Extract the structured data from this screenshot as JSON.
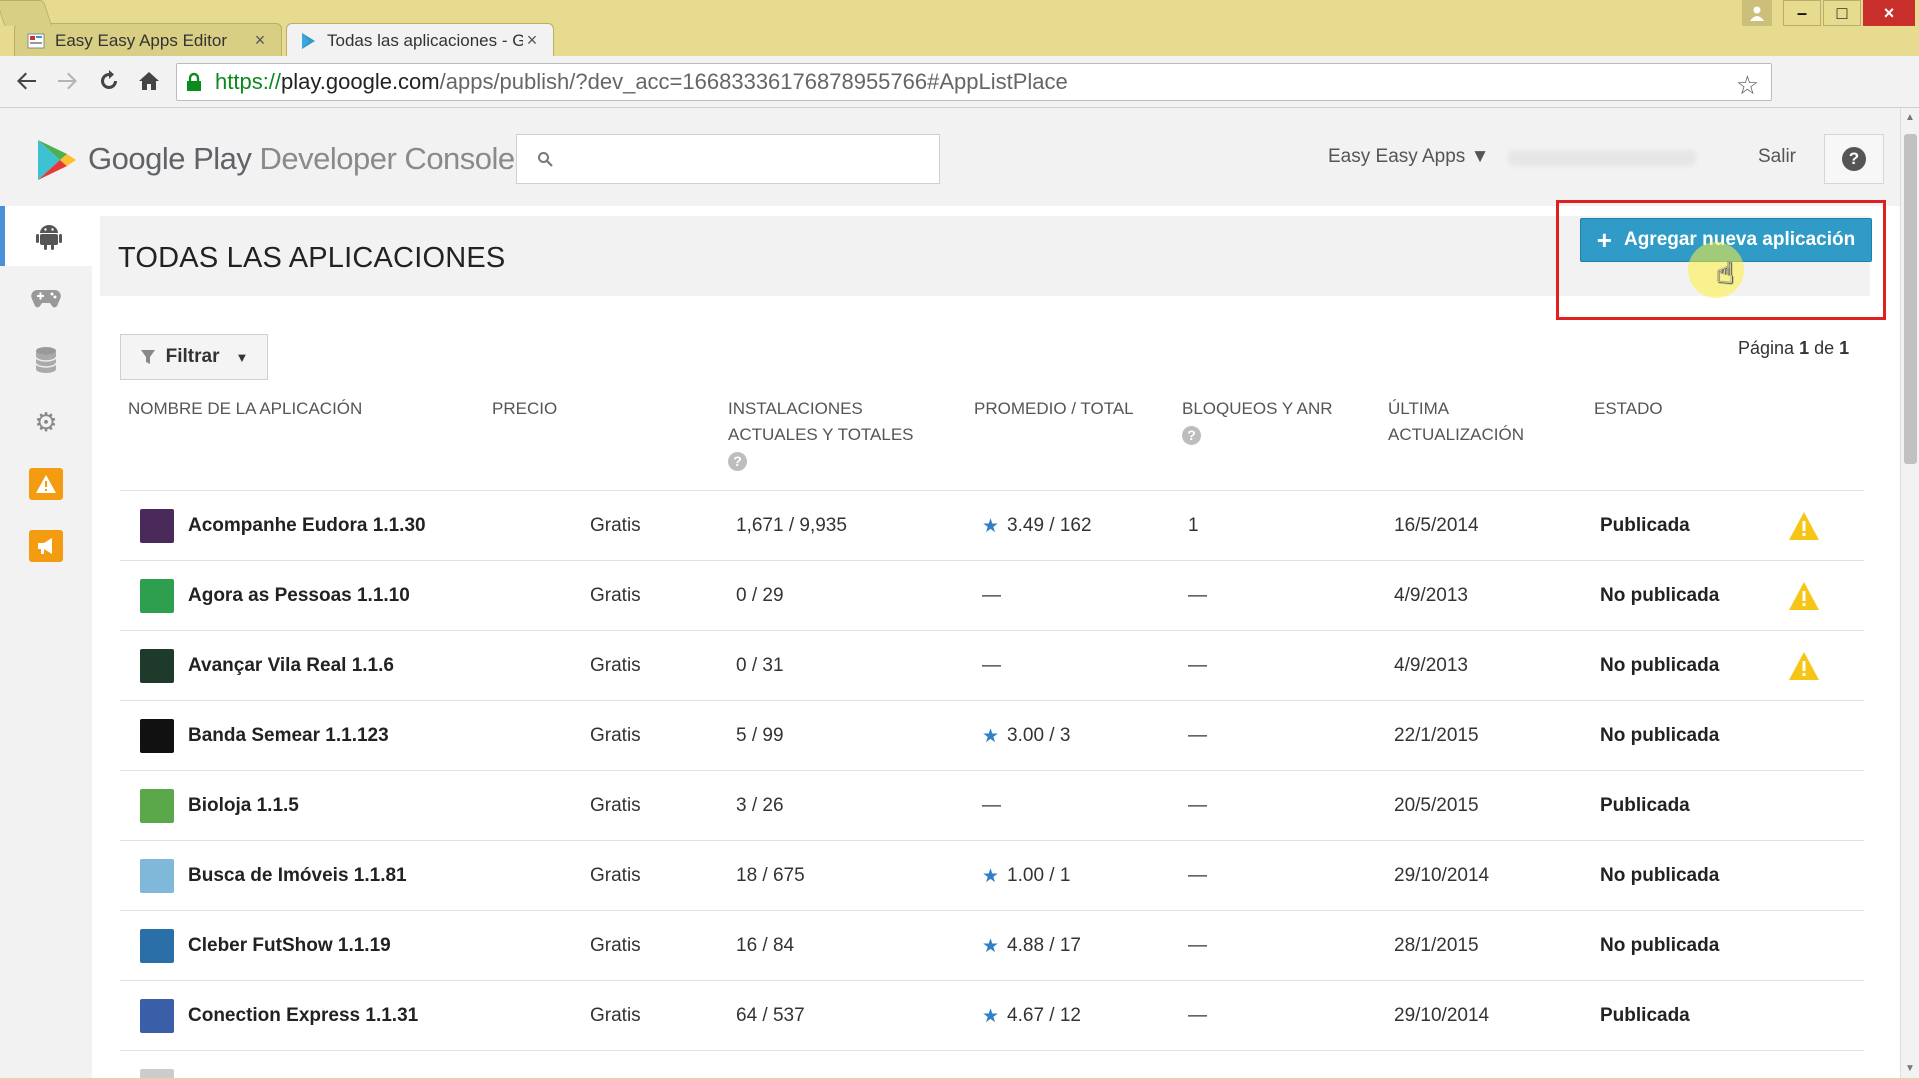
{
  "browser": {
    "tabs": [
      {
        "title": "Easy Easy Apps Editor",
        "close": "×"
      },
      {
        "title": "Todas las aplicaciones - G",
        "close": "×"
      }
    ],
    "window_buttons": {
      "minimize": "–",
      "maximize": "□",
      "close": "×"
    },
    "url": {
      "scheme": "https://",
      "host": "play.google.com",
      "path": "/apps/publish/?dev_acc=16683336176878955766#AppListPlace"
    },
    "extension_label": "⌘"
  },
  "header": {
    "brand_google_play": "Google Play",
    "brand_console": "Developer Console",
    "search_placeholder": "",
    "account": "Easy Easy Apps ▼",
    "signout": "Salir",
    "help": "?"
  },
  "colors": {
    "accent_button": "#2f9bc6",
    "highlight_box": "#e02020",
    "rating_star": "#2f80c8",
    "warning": "#f5c518",
    "sidebar_orange": "#f39c12"
  },
  "sidebar": {
    "items": [
      {
        "icon": "android-icon",
        "glyph": "🤖"
      },
      {
        "icon": "gamepad-icon",
        "glyph": "🎮"
      },
      {
        "icon": "database-icon",
        "glyph": "≣"
      },
      {
        "icon": "gear-icon",
        "glyph": "⚙"
      },
      {
        "icon": "alert-icon",
        "glyph": "!"
      },
      {
        "icon": "announcement-icon",
        "glyph": "📢"
      }
    ]
  },
  "main": {
    "title": "TODAS LAS APLICACIONES",
    "add_button": "Agregar nueva aplicación",
    "filter_button": "Filtrar",
    "pager": {
      "prefix": "Página",
      "current": "1",
      "separator": "de",
      "total": "1"
    },
    "columns": [
      {
        "line1": "NOMBRE DE LA APLICACIÓN",
        "line2": "",
        "help": false
      },
      {
        "line1": "PRECIO",
        "line2": "",
        "help": false
      },
      {
        "line1": "INSTALACIONES",
        "line2": "ACTUALES Y TOTALES",
        "help": true
      },
      {
        "line1": "PROMEDIO / TOTAL",
        "line2": "",
        "help": false
      },
      {
        "line1": "BLOQUEOS Y ANR",
        "line2": "",
        "help": true
      },
      {
        "line1": "ÚLTIMA",
        "line2": "ACTUALIZACIÓN",
        "help": false
      },
      {
        "line1": "ESTADO",
        "line2": "",
        "help": false
      }
    ],
    "apps": [
      {
        "name": "Acompanhe Eudora 1.1.30",
        "price": "Gratis",
        "installs": "1,671  /  9,935",
        "rating": "3.49  /  162",
        "crashes": "1",
        "updated": "16/5/2014",
        "status": "Publicada",
        "warning": true,
        "icon_color": "#4a2a5a"
      },
      {
        "name": "Agora as Pessoas 1.1.10",
        "price": "Gratis",
        "installs": "0  /  29",
        "rating": "—",
        "crashes": "—",
        "updated": "4/9/2013",
        "status": "No publicada",
        "warning": true,
        "icon_color": "#2e9e4f"
      },
      {
        "name": "Avançar Vila Real 1.1.6",
        "price": "Gratis",
        "installs": "0  /  31",
        "rating": "—",
        "crashes": "—",
        "updated": "4/9/2013",
        "status": "No publicada",
        "warning": true,
        "icon_color": "#1e3a2a"
      },
      {
        "name": "Banda Semear 1.1.123",
        "price": "Gratis",
        "installs": "5  /  99",
        "rating": "3.00  /  3",
        "crashes": "—",
        "updated": "22/1/2015",
        "status": "No publicada",
        "warning": false,
        "icon_color": "#111111"
      },
      {
        "name": "Bioloja 1.1.5",
        "price": "Gratis",
        "installs": "3  /  26",
        "rating": "—",
        "crashes": "—",
        "updated": "20/5/2015",
        "status": "Publicada",
        "warning": false,
        "icon_color": "#5aa84a"
      },
      {
        "name": "Busca de Imóveis 1.1.81",
        "price": "Gratis",
        "installs": "18  /  675",
        "rating": "1.00  /  1",
        "crashes": "—",
        "updated": "29/10/2014",
        "status": "No publicada",
        "warning": false,
        "icon_color": "#7fb8d8"
      },
      {
        "name": "Cleber FutShow 1.1.19",
        "price": "Gratis",
        "installs": "16  /  84",
        "rating": "4.88  /  17",
        "crashes": "—",
        "updated": "28/1/2015",
        "status": "No publicada",
        "warning": false,
        "icon_color": "#2a6fa8"
      },
      {
        "name": "Conection Express 1.1.31",
        "price": "Gratis",
        "installs": "64  /  537",
        "rating": "4.67  /  12",
        "crashes": "—",
        "updated": "29/10/2014",
        "status": "Publicada",
        "warning": false,
        "icon_color": "#3a5ea8"
      },
      {
        "name": "",
        "price": "",
        "installs": "",
        "rating": "",
        "crashes": "",
        "updated": "",
        "status": "",
        "warning": false,
        "icon_color": "#cccccc"
      }
    ]
  }
}
